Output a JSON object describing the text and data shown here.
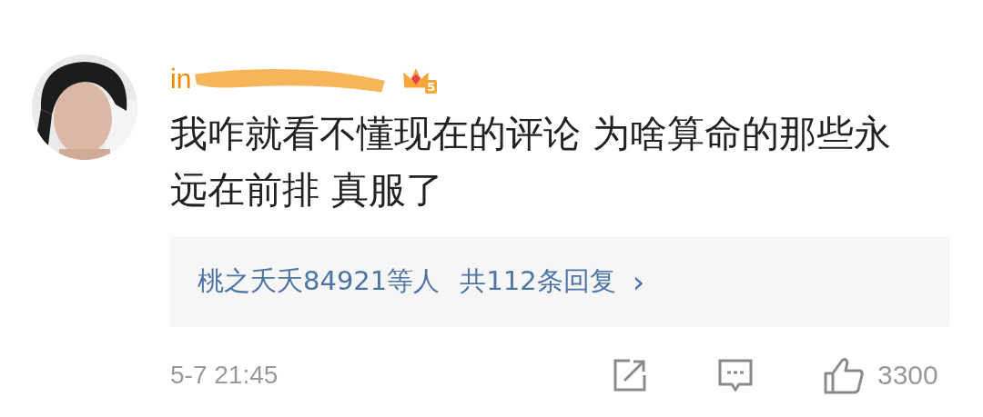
{
  "comment": {
    "username": "in",
    "vip_level": "5",
    "text": "我咋就看不懂现在的评论 为啥算命的那些永远在前排 真服了",
    "replies": {
      "users": "桃之夭夭84921等人",
      "count": "共112条回复",
      "chevron": "›"
    },
    "time": "5-7 21:45",
    "likes": "3300"
  }
}
